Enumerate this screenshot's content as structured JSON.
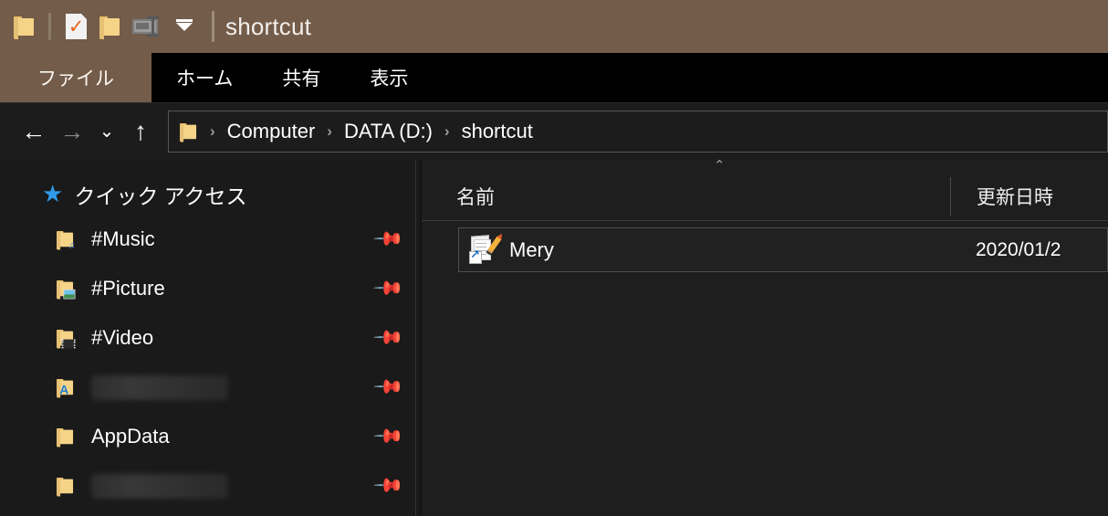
{
  "window": {
    "title": "shortcut",
    "theme_colors": {
      "titlebar": "#735C4A",
      "ribbon": "#000000",
      "sidebar": "#1A1A1A",
      "content": "#1E1E1E",
      "accent_star": "#2F9BEA",
      "shortcut_badge": "#1A6FC4"
    }
  },
  "quick_access_toolbar": {
    "items": [
      {
        "name": "properties-folder-icon",
        "icon": "folder-icon"
      },
      {
        "name": "properties-icon",
        "icon": "document-check-icon"
      },
      {
        "name": "new-folder-icon",
        "icon": "folder-icon"
      },
      {
        "name": "properties-panel-icon",
        "icon": "properties-icon"
      },
      {
        "name": "customize-dropdown",
        "icon": "caret-down-icon"
      }
    ]
  },
  "ribbon": {
    "tabs": [
      {
        "label": "ファイル",
        "active": true
      },
      {
        "label": "ホーム",
        "active": false
      },
      {
        "label": "共有",
        "active": false
      },
      {
        "label": "表示",
        "active": false
      }
    ]
  },
  "navigation": {
    "back": "←",
    "forward": "→",
    "recent": "⌄",
    "up": "↑",
    "back_enabled": true,
    "forward_enabled": false
  },
  "breadcrumb": {
    "separator": "›",
    "items": [
      "Computer",
      "DATA (D:)",
      "shortcut"
    ]
  },
  "sidebar": {
    "root": {
      "label": "クイック アクセス",
      "icon": "star-icon"
    },
    "items": [
      {
        "label": "#Music",
        "icon": "folder-music-icon",
        "pinned": true,
        "redacted": false
      },
      {
        "label": "#Picture",
        "icon": "folder-picture-icon",
        "pinned": true,
        "redacted": false
      },
      {
        "label": "#Video",
        "icon": "folder-video-icon",
        "pinned": true,
        "redacted": false
      },
      {
        "label": "",
        "icon": "folder-app-icon",
        "pinned": true,
        "redacted": true
      },
      {
        "label": "AppData",
        "icon": "folder-icon",
        "pinned": true,
        "redacted": false
      },
      {
        "label": "",
        "icon": "folder-icon",
        "pinned": true,
        "redacted": true
      }
    ],
    "pin_icon": "pin-icon"
  },
  "file_list": {
    "sort_indicator": "⌃",
    "sort_column": "名前",
    "columns": [
      {
        "label": "名前",
        "key": "name"
      },
      {
        "label": "更新日時",
        "key": "date"
      }
    ],
    "rows": [
      {
        "name": "Mery",
        "date": "2020/01/2",
        "icon": "text-editor-shortcut-icon",
        "selected": true
      }
    ]
  }
}
